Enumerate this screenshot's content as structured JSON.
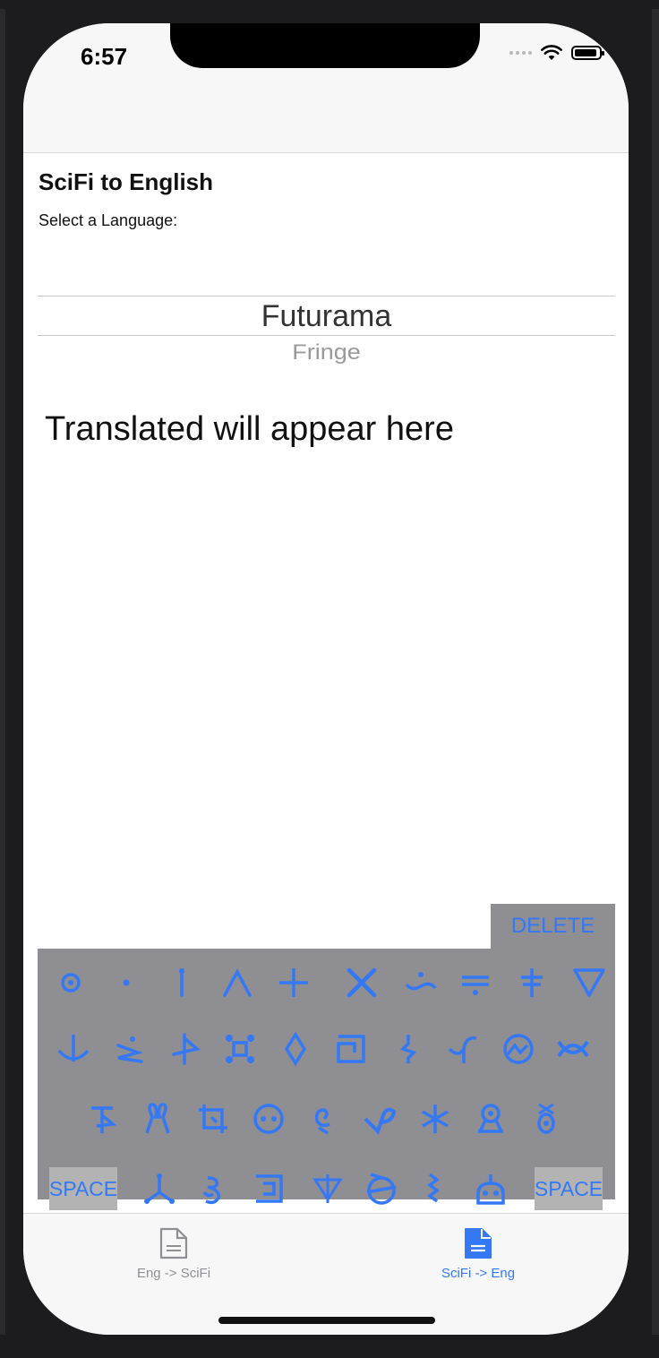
{
  "status_bar": {
    "time": "6:57"
  },
  "content": {
    "title": "SciFi to English",
    "select_label": "Select a Language:",
    "picker": {
      "selected": "Futurama",
      "next": "Fringe"
    },
    "translated_placeholder": "Translated will appear here"
  },
  "keyboard": {
    "delete_label": "DELETE",
    "space_label": "SPACE",
    "key_color": "#3478f6",
    "background_color": "#8e8e93"
  },
  "tab_bar": {
    "tabs": [
      {
        "label": "Eng -> SciFi",
        "icon": "document-outline-icon",
        "selected": false
      },
      {
        "label": "SciFi -> Eng",
        "icon": "document-filled-icon",
        "selected": true
      }
    ],
    "accent_color": "#3478f6",
    "inactive_color": "#8e8e93"
  }
}
